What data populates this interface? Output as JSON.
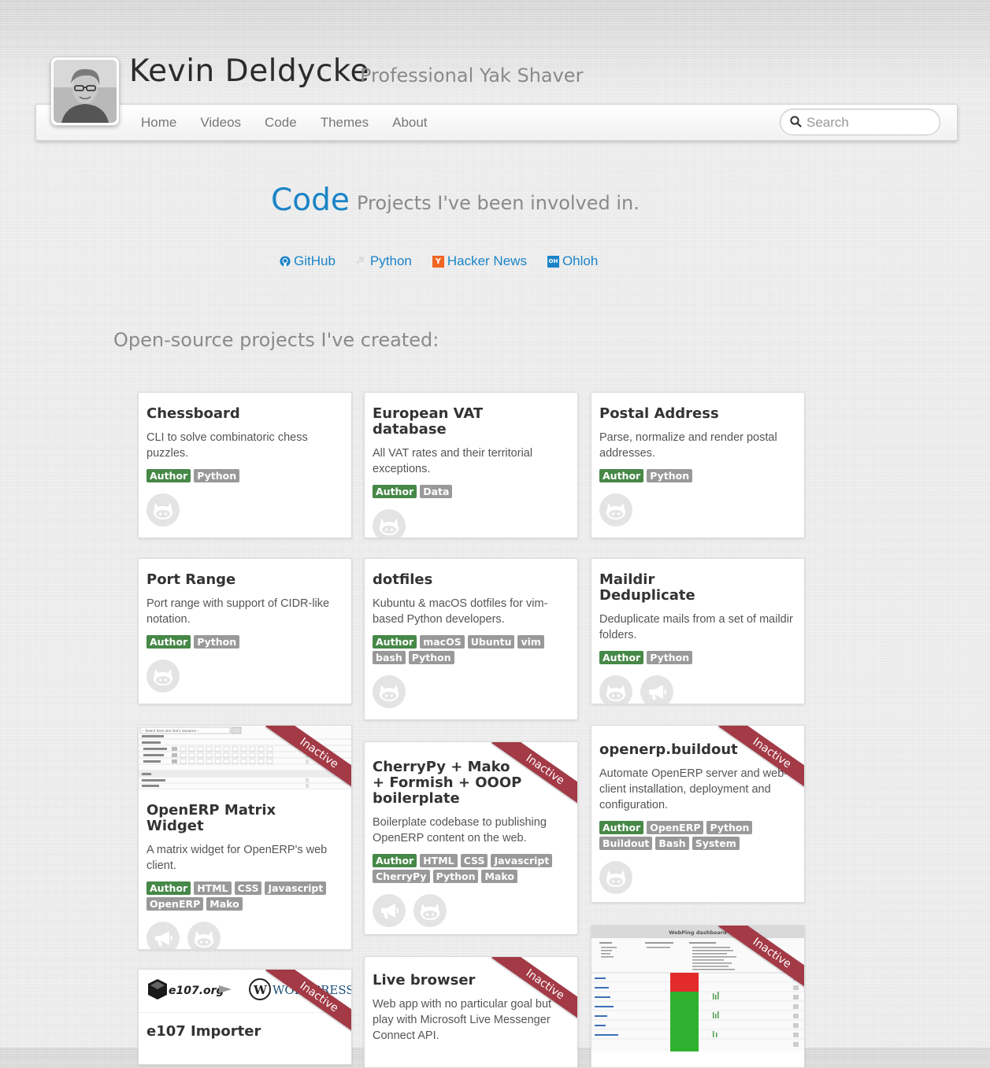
{
  "site": {
    "name": "Kevin Deldycke",
    "tagline": "Professional Yak Shaver",
    "nav": [
      "Home",
      "Videos",
      "Code",
      "Themes",
      "About"
    ],
    "search_placeholder": "Search"
  },
  "page": {
    "title": "Code",
    "subtitle": "Projects I've been involved in.",
    "links": [
      {
        "label": "GitHub",
        "icon": "github-icon"
      },
      {
        "label": "Python",
        "icon": "python-icon"
      },
      {
        "label": "Hacker News",
        "icon": "hacker-news-icon",
        "icon_text": "Y"
      },
      {
        "label": "Ohloh",
        "icon": "ohloh-icon",
        "icon_text": "OH"
      }
    ],
    "section_heading": "Open-source projects I've created:"
  },
  "ribbon_label": "Inactive",
  "projects": [
    {
      "title": "Chessboard",
      "desc": "CLI to solve combinatoric chess puzzles.",
      "tags": [
        "Author",
        "Python"
      ]
    },
    {
      "title": "European VAT database",
      "desc": "All VAT rates and their territorial exceptions.",
      "tags": [
        "Author",
        "Data"
      ]
    },
    {
      "title": "Postal Address",
      "desc": "Parse, normalize and render postal addresses.",
      "tags": [
        "Author",
        "Python"
      ]
    },
    {
      "title": "Port Range",
      "desc": "Port range with support of CIDR-like notation.",
      "tags": [
        "Author",
        "Python"
      ]
    },
    {
      "title": "dotfiles",
      "desc": "Kubuntu & macOS dotfiles for vim-based Python developers.",
      "tags": [
        "Author",
        "macOS",
        "Ubuntu",
        "vim",
        "bash",
        "Python"
      ]
    },
    {
      "title": "Maildir Deduplicate",
      "desc": "Deduplicate mails from a set of maildir folders.",
      "tags": [
        "Author",
        "Python"
      ]
    },
    {
      "title": "OpenERP Matrix Widget",
      "desc": "A matrix widget for OpenERP's web client.",
      "tags": [
        "Author",
        "HTML",
        "CSS",
        "Javascript",
        "OpenERP",
        "Mako"
      ]
    },
    {
      "title": "CherryPy + Mako + Formish + OOOP boilerplate",
      "desc": "Boilerplate codebase to publishing OpenERP content on the web.",
      "tags": [
        "Author",
        "HTML",
        "CSS",
        "Javascript",
        "CherryPy",
        "Python",
        "Mako"
      ]
    },
    {
      "title": "openerp.buildout",
      "desc": "Automate OpenERP server and web-client installation, deployment and configuration.",
      "tags": [
        "Author",
        "OpenERP",
        "Python",
        "Buildout",
        "Bash",
        "System"
      ]
    },
    {
      "title": "e107 Importer",
      "desc": "",
      "tags": []
    },
    {
      "title": "Live browser",
      "desc": "Web app with no particular goal but play with Microsoft Live Messenger Connect API.",
      "tags": []
    },
    {
      "title": "",
      "desc": "",
      "tags": []
    }
  ],
  "thumbs": {
    "matrix_select": "-- Select here one line's resource --",
    "webping_title": "WebPing dashboard",
    "e107_logo": "e107.org",
    "wp_logo": "WORDPRESS"
  },
  "colors": {
    "link": "#1a84c7",
    "author_tag": "#468847",
    "tag": "#999999",
    "ribbon": "#a33a46"
  }
}
